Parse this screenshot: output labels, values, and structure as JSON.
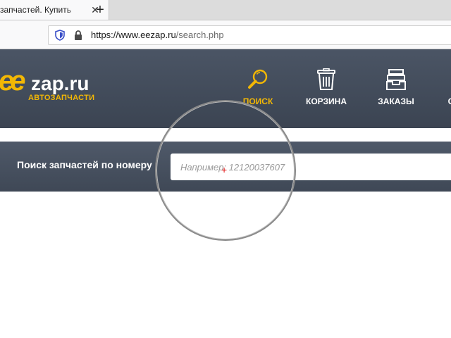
{
  "browser": {
    "tab_title": "запчастей. Купить",
    "tab_close_glyph": "✕",
    "new_tab_glyph": "+",
    "url_host": "https://www.eezap.ru",
    "url_path": "/search.php"
  },
  "site": {
    "logo_mark": "ee",
    "logo_text": "zap.ru",
    "logo_subtitle": "АВТОЗАПЧАСТИ",
    "nav": [
      {
        "label": "ПОИСК",
        "icon": "magnifier-icon",
        "active": true
      },
      {
        "label": "КОРЗИНА",
        "icon": "trash-bin-icon",
        "active": false
      },
      {
        "label": "ЗАКАЗЫ",
        "icon": "stacked-trays-icon",
        "active": false
      },
      {
        "label": "С",
        "icon": "",
        "active": false
      }
    ],
    "search": {
      "label": "Поиск запчастей по номеру",
      "placeholder": "Например: 12120037607",
      "value": ""
    }
  },
  "colors": {
    "accent": "#f2b705",
    "header_bg": "#434c5a",
    "cursor": "#e01010"
  }
}
